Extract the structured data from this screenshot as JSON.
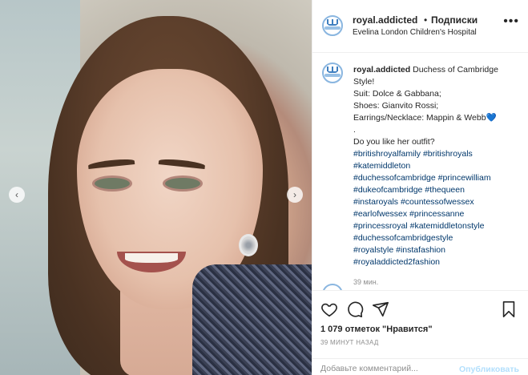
{
  "header": {
    "username": "royal.addicted",
    "dot": "•",
    "follow_label": "Подписки",
    "location": "Evelina London Children's Hospital",
    "more_icon": "more-horizontal-icon"
  },
  "carousel": {
    "prev_glyph": "‹",
    "next_glyph": "›"
  },
  "caption": {
    "username": "royal.addicted",
    "first_line": "Duchess of Cambridge Style!",
    "lines": [
      "Suit: Dolce & Gabbana;",
      "Shoes: Gianvito Rossi;",
      "Earrings/Necklace: Mappin & Webb",
      ".",
      "Do you like her outfit?"
    ],
    "heart": "💙",
    "hashtag_lines": [
      "#britishroyalfamily #britishroyals",
      "#katemiddleton",
      "#duchessofcambridge #princewilliam",
      "#dukeofcambridge #thequeen",
      "#instaroyals #countessofwessex",
      "#earlofwessex #princessanne",
      "#princessroyal #katemiddletonstyle",
      "#duchessofcambridgestyle",
      "#royalstyle #instafashion",
      "#royaladdicted2fashion"
    ],
    "time": "39 мин."
  },
  "actions": {
    "likes": "1 079 отметок \"Нравится\"",
    "time_ago": "39 МИНУТ НАЗАД",
    "comment_placeholder": "Добавьте комментарий...",
    "publish_label": "Опубликовать"
  },
  "colors": {
    "link": "#00376b",
    "publish_disabled": "#b2dffc",
    "border": "#efefef"
  }
}
